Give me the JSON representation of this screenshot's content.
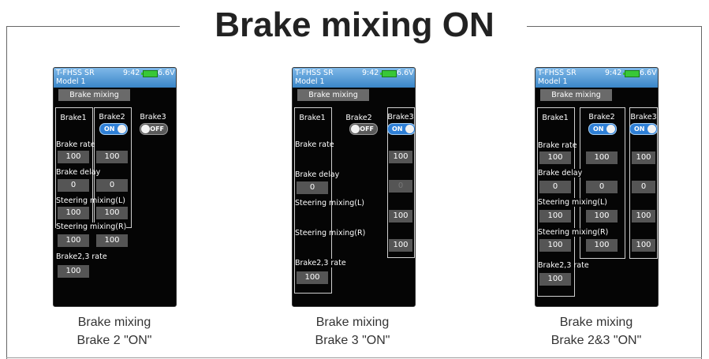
{
  "title": "Brake mixing ON",
  "status": {
    "system": "T-FHSS SR",
    "time": "9:42",
    "voltage": "6.6V",
    "model": "Model 1",
    "battery_icon": "battery-icon"
  },
  "screen_title": "Brake mixing",
  "columns": {
    "brake1": "Brake1",
    "brake2": "Brake2",
    "brake3": "Brake3"
  },
  "labels": {
    "brake_rate": "Brake rate",
    "brake_delay": "Brake delay",
    "steering_mixing_l": "Steering mixing(L)",
    "steering_mixing_r": "Steering mixing(R)",
    "brake23_rate": "Brake2,3 rate"
  },
  "panels": [
    {
      "brake2": "ON",
      "brake3": "OFF",
      "brake_rate": [
        "100",
        "100"
      ],
      "brake_delay": [
        "0",
        "0"
      ],
      "steering_l": [
        "100",
        "100"
      ],
      "steering_r": [
        "100",
        "100"
      ],
      "brake23_rate": "100",
      "caption_line1": "Brake mixing",
      "caption_line2": "Brake 2 \"ON\""
    },
    {
      "brake2": "OFF",
      "brake3": "ON",
      "brake_rate": "100",
      "brake_delay": [
        "0",
        "0"
      ],
      "steering_l": "100",
      "steering_r": "100",
      "brake23_rate": "100",
      "caption_line1": "Brake mixing",
      "caption_line2": "Brake 3 \"ON\""
    },
    {
      "brake2": "ON",
      "brake3": "ON",
      "brake_rate": [
        "100",
        "100",
        "100"
      ],
      "brake_delay": [
        "0",
        "0",
        "0"
      ],
      "steering_l": [
        "100",
        "100",
        "100"
      ],
      "steering_r": [
        "100",
        "100",
        "100"
      ],
      "brake23_rate": "100",
      "caption_line1": "Brake mixing",
      "caption_line2": "Brake 2&3 \"ON\""
    }
  ]
}
